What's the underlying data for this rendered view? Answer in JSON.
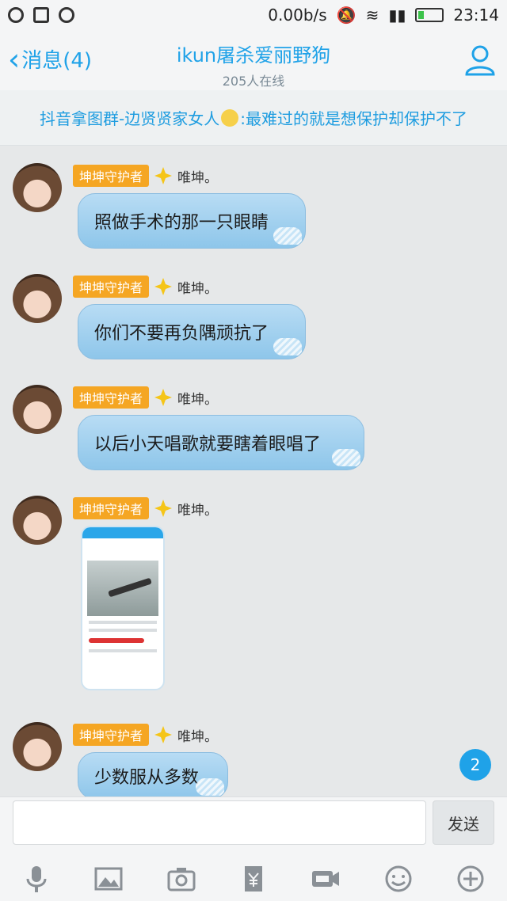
{
  "status_bar": {
    "network_speed": "0.00b/s",
    "time": "23:14"
  },
  "header": {
    "back_label": "消息(4)",
    "title": "ikun屠杀爱丽野狗",
    "subtitle": "205人在线"
  },
  "notice": {
    "text_before": "抖音拿图群-边贤贤家女人",
    "text_after": ":最难过的就是想保护却保护不了"
  },
  "messages": [
    {
      "badge": "坤坤守护者",
      "username": "唯坤。",
      "text": "照做手术的那一只眼睛"
    },
    {
      "badge": "坤坤守护者",
      "username": "唯坤。",
      "text": "你们不要再负隅顽抗了"
    },
    {
      "badge": "坤坤守护者",
      "username": "唯坤。",
      "text": "以后小天唱歌就要瞎着眼唱了"
    },
    {
      "badge": "坤坤守护者",
      "username": "唯坤。",
      "type": "image"
    },
    {
      "badge": "坤坤守护者",
      "username": "唯坤。",
      "text": "少数服从多数"
    }
  ],
  "unread_count": "2",
  "composer": {
    "send_label": "发送"
  },
  "toolbar_icons": [
    "microphone-icon",
    "image-icon",
    "camera-icon",
    "red-packet-icon",
    "gif-icon",
    "emoji-icon",
    "plus-icon"
  ]
}
